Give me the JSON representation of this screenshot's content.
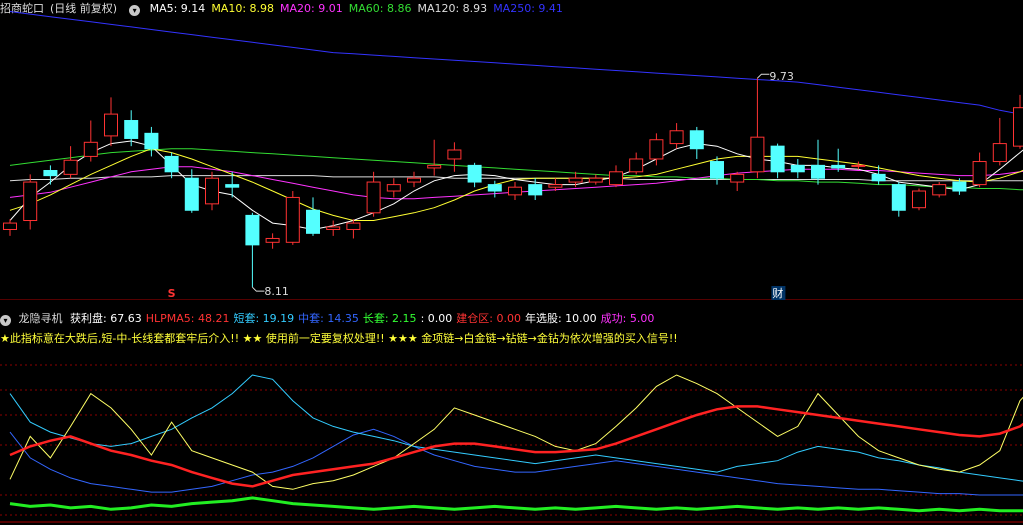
{
  "main": {
    "title": "招商蛇口",
    "mode": "(日线 前复权)",
    "ma": [
      {
        "label": "MA5:",
        "value": "9.14",
        "color": "#ffffff"
      },
      {
        "label": "MA10:",
        "value": "8.98",
        "color": "#ffff33"
      },
      {
        "label": "MA20:",
        "value": "9.01",
        "color": "#ff33ff"
      },
      {
        "label": "MA60:",
        "value": "8.86",
        "color": "#33dd33"
      },
      {
        "label": "MA120:",
        "value": "8.93",
        "color": "#dddddd"
      },
      {
        "label": "MA250:",
        "value": "9.41",
        "color": "#3333ff"
      }
    ],
    "high_label": "9.73",
    "low_label": "8.11",
    "markers": {
      "s": "S",
      "cai": "财"
    },
    "candles": [
      [
        8.55,
        8.6,
        8.5,
        8.63
      ],
      [
        8.62,
        8.92,
        8.55,
        8.98
      ],
      [
        9.01,
        8.97,
        8.9,
        9.05
      ],
      [
        8.98,
        9.09,
        8.95,
        9.2
      ],
      [
        9.12,
        9.23,
        9.08,
        9.4
      ],
      [
        9.28,
        9.45,
        9.2,
        9.58
      ],
      [
        9.4,
        9.26,
        9.2,
        9.48
      ],
      [
        9.3,
        9.18,
        9.12,
        9.35
      ],
      [
        9.12,
        9.0,
        8.95,
        9.15
      ],
      [
        8.95,
        8.7,
        8.68,
        9.02
      ],
      [
        8.75,
        8.95,
        8.7,
        9.0
      ],
      [
        8.9,
        8.88,
        8.8,
        9.0
      ],
      [
        8.66,
        8.43,
        8.1,
        8.68
      ],
      [
        8.45,
        8.48,
        8.4,
        8.52
      ],
      [
        8.45,
        8.8,
        8.43,
        8.85
      ],
      [
        8.7,
        8.52,
        8.5,
        8.8
      ],
      [
        8.55,
        8.57,
        8.5,
        8.62
      ],
      [
        8.55,
        8.6,
        8.48,
        8.63
      ],
      [
        8.68,
        8.92,
        8.65,
        9.0
      ],
      [
        8.85,
        8.9,
        8.8,
        8.95
      ],
      [
        8.92,
        8.95,
        8.88,
        9.0
      ],
      [
        9.03,
        9.05,
        8.97,
        9.25
      ],
      [
        9.1,
        9.17,
        9.0,
        9.23
      ],
      [
        9.05,
        8.92,
        8.88,
        9.07
      ],
      [
        8.9,
        8.85,
        8.8,
        8.93
      ],
      [
        8.82,
        8.88,
        8.78,
        8.92
      ],
      [
        8.9,
        8.82,
        8.78,
        8.95
      ],
      [
        8.88,
        8.9,
        8.85,
        8.95
      ],
      [
        8.92,
        8.95,
        8.88,
        9.0
      ],
      [
        8.92,
        8.95,
        8.9,
        8.98
      ],
      [
        8.9,
        9.0,
        8.88,
        9.05
      ],
      [
        9.0,
        9.1,
        8.98,
        9.15
      ],
      [
        9.1,
        9.25,
        9.05,
        9.3
      ],
      [
        9.22,
        9.32,
        9.18,
        9.38
      ],
      [
        9.32,
        9.18,
        9.1,
        9.35
      ],
      [
        9.08,
        8.95,
        8.9,
        9.12
      ],
      [
        8.92,
        8.98,
        8.85,
        9.0
      ],
      [
        9.0,
        9.27,
        8.95,
        9.73
      ],
      [
        9.2,
        9.0,
        8.95,
        9.22
      ],
      [
        9.05,
        9.0,
        8.95,
        9.1
      ],
      [
        9.05,
        8.95,
        8.9,
        9.25
      ],
      [
        9.05,
        9.03,
        9.0,
        9.18
      ],
      [
        9.05,
        9.05,
        9.02,
        9.08
      ],
      [
        8.98,
        8.93,
        8.9,
        9.05
      ],
      [
        8.9,
        8.7,
        8.65,
        8.92
      ],
      [
        8.72,
        8.85,
        8.7,
        8.87
      ],
      [
        8.82,
        8.9,
        8.8,
        8.92
      ],
      [
        8.92,
        8.85,
        8.82,
        8.95
      ],
      [
        8.9,
        9.08,
        8.88,
        9.15
      ],
      [
        9.08,
        9.22,
        9.05,
        9.42
      ],
      [
        9.2,
        9.5,
        9.18,
        9.6
      ],
      [
        9.38,
        9.48,
        9.25,
        9.62
      ]
    ],
    "ma5": [
      8.62,
      8.8,
      8.92,
      9.05,
      9.15,
      9.22,
      9.24,
      9.2,
      9.05,
      8.9,
      8.85,
      8.82,
      8.7,
      8.6,
      8.58,
      8.55,
      8.58,
      8.62,
      8.68,
      8.75,
      8.85,
      8.93,
      8.97,
      8.98,
      8.97,
      8.94,
      8.92,
      8.9,
      8.9,
      8.93,
      8.96,
      9.02,
      9.1,
      9.18,
      9.22,
      9.2,
      9.14,
      9.1,
      9.08,
      9.05,
      9.05,
      9.03,
      9.02,
      8.98,
      8.92,
      8.9,
      8.88,
      8.86,
      8.9,
      9.02,
      9.15,
      9.28
    ],
    "ma10": [
      8.7,
      8.75,
      8.82,
      8.9,
      8.98,
      9.05,
      9.12,
      9.18,
      9.15,
      9.1,
      9.04,
      8.98,
      8.92,
      8.85,
      8.78,
      8.71,
      8.66,
      8.62,
      8.62,
      8.65,
      8.68,
      8.72,
      8.78,
      8.85,
      8.9,
      8.94,
      8.95,
      8.95,
      8.95,
      8.95,
      8.95,
      8.96,
      8.98,
      9.02,
      9.06,
      9.1,
      9.12,
      9.12,
      9.12,
      9.12,
      9.1,
      9.08,
      9.06,
      9.03,
      9.0,
      8.97,
      8.95,
      8.93,
      8.92,
      8.95,
      9.0,
      9.08
    ],
    "ma20": [
      8.8,
      8.82,
      8.84,
      8.88,
      8.92,
      8.96,
      9.0,
      9.02,
      9.04,
      9.04,
      9.02,
      9.0,
      8.97,
      8.94,
      8.91,
      8.88,
      8.85,
      8.82,
      8.8,
      8.79,
      8.79,
      8.8,
      8.81,
      8.82,
      8.83,
      8.84,
      8.85,
      8.86,
      8.87,
      8.88,
      8.89,
      8.9,
      8.91,
      8.93,
      8.95,
      8.97,
      8.99,
      9.0,
      9.01,
      9.02,
      9.02,
      9.02,
      9.01,
      9.01,
      9.0,
      8.99,
      8.98,
      8.97,
      8.97,
      8.98,
      9.0,
      9.02
    ],
    "ma60": [
      9.05,
      9.07,
      9.09,
      9.11,
      9.13,
      9.15,
      9.16,
      9.17,
      9.18,
      9.18,
      9.17,
      9.16,
      9.15,
      9.14,
      9.13,
      9.12,
      9.11,
      9.1,
      9.09,
      9.08,
      9.07,
      9.06,
      9.05,
      9.04,
      9.03,
      9.02,
      9.01,
      9.0,
      8.99,
      8.98,
      8.97,
      8.97,
      8.96,
      8.96,
      8.95,
      8.95,
      8.94,
      8.94,
      8.93,
      8.93,
      8.92,
      8.92,
      8.91,
      8.9,
      8.9,
      8.89,
      8.88,
      8.88,
      8.87,
      8.87,
      8.86,
      8.86
    ],
    "ma120": [
      8.93,
      8.94,
      8.94,
      8.95,
      8.95,
      8.96,
      8.96,
      8.96,
      8.97,
      8.97,
      8.97,
      8.97,
      8.97,
      8.97,
      8.97,
      8.97,
      8.96,
      8.96,
      8.96,
      8.96,
      8.96,
      8.96,
      8.95,
      8.95,
      8.95,
      8.95,
      8.95,
      8.95,
      8.95,
      8.95,
      8.95,
      8.94,
      8.94,
      8.94,
      8.94,
      8.94,
      8.94,
      8.94,
      8.94,
      8.94,
      8.94,
      8.94,
      8.94,
      8.93,
      8.93,
      8.93,
      8.93,
      8.93,
      8.93,
      8.93,
      8.93,
      8.93
    ],
    "ma250": [
      10.25,
      10.23,
      10.21,
      10.19,
      10.17,
      10.15,
      10.13,
      10.11,
      10.09,
      10.07,
      10.05,
      10.03,
      10.01,
      9.99,
      9.97,
      9.95,
      9.93,
      9.92,
      9.91,
      9.9,
      9.89,
      9.88,
      9.87,
      9.86,
      9.85,
      9.84,
      9.83,
      9.82,
      9.81,
      9.8,
      9.79,
      9.78,
      9.77,
      9.76,
      9.75,
      9.74,
      9.73,
      9.72,
      9.71,
      9.7,
      9.68,
      9.66,
      9.64,
      9.62,
      9.6,
      9.58,
      9.56,
      9.54,
      9.52,
      9.48,
      9.45,
      9.41
    ]
  },
  "sub": {
    "indicator_name": "龙隐寻机",
    "fields": [
      {
        "label": "获利盘:",
        "value": "67.63",
        "color": "#ffffff"
      },
      {
        "label": "HLPMA5:",
        "value": "48.21",
        "color": "#ff3333"
      },
      {
        "label": "短套:",
        "value": "19.19",
        "color": "#33ccff"
      },
      {
        "label": "中套:",
        "value": "14.35",
        "color": "#3366ff"
      },
      {
        "label": "长套:",
        "value": "2.15",
        "color": "#33ff33"
      },
      {
        "label": ":",
        "value": "0.00",
        "color": "#ffffff"
      },
      {
        "label": "建仓区:",
        "value": "0.00",
        "color": "#ff3333"
      },
      {
        "label": "年选股:",
        "value": "10.00",
        "color": "#ffffff"
      },
      {
        "label": "成功:",
        "value": "5.00",
        "color": "#ff33ff"
      }
    ],
    "note": "★此指标意在大跌后,短-中-长线套都套牢后介入!! ★★ 使用前一定要复权处理!! ★★★ 金项链→白金链→钻链→金钻为依次增强的买入信号!!",
    "yellow": [
      25,
      55,
      40,
      62,
      85,
      75,
      60,
      42,
      65,
      45,
      40,
      35,
      30,
      20,
      18,
      22,
      24,
      28,
      34,
      40,
      50,
      60,
      75,
      70,
      65,
      60,
      55,
      48,
      45,
      50,
      62,
      75,
      90,
      98,
      92,
      85,
      75,
      65,
      55,
      62,
      85,
      70,
      55,
      45,
      40,
      35,
      32,
      30,
      35,
      45,
      80,
      95
    ],
    "red": [
      42,
      48,
      52,
      55,
      50,
      45,
      42,
      38,
      35,
      30,
      26,
      22,
      20,
      24,
      28,
      30,
      32,
      34,
      36,
      40,
      44,
      48,
      50,
      50,
      48,
      46,
      44,
      44,
      45,
      46,
      50,
      55,
      60,
      65,
      70,
      74,
      76,
      76,
      74,
      72,
      70,
      68,
      66,
      64,
      62,
      60,
      58,
      56,
      55,
      57,
      62,
      72
    ],
    "cyan": [
      85,
      65,
      58,
      54,
      50,
      48,
      50,
      55,
      60,
      68,
      75,
      85,
      98,
      95,
      80,
      68,
      62,
      58,
      55,
      52,
      48,
      46,
      44,
      42,
      40,
      38,
      36,
      38,
      40,
      42,
      40,
      38,
      36,
      34,
      32,
      30,
      34,
      36,
      38,
      44,
      48,
      46,
      44,
      40,
      38,
      35,
      33,
      30,
      28,
      26,
      24,
      22
    ],
    "blue": [
      58,
      40,
      32,
      26,
      22,
      20,
      18,
      16,
      16,
      18,
      20,
      24,
      28,
      30,
      34,
      40,
      48,
      56,
      60,
      55,
      48,
      42,
      38,
      34,
      32,
      30,
      30,
      32,
      34,
      36,
      38,
      36,
      34,
      32,
      30,
      28,
      26,
      24,
      22,
      21,
      20,
      19,
      18,
      18,
      17,
      16,
      15,
      15,
      14,
      14,
      14,
      14
    ],
    "green": [
      8,
      6,
      7,
      5,
      6,
      4,
      5,
      7,
      6,
      8,
      9,
      10,
      12,
      10,
      8,
      7,
      6,
      5,
      4,
      5,
      6,
      5,
      4,
      5,
      6,
      5,
      4,
      5,
      4,
      5,
      6,
      5,
      4,
      5,
      4,
      5,
      6,
      5,
      4,
      5,
      4,
      5,
      4,
      5,
      4,
      3,
      4,
      3,
      4,
      3,
      3,
      3
    ]
  },
  "colors": {
    "up": "#ff3333",
    "down": "#54ffff",
    "grid": "#8b0000",
    "border": "#aa0000"
  }
}
